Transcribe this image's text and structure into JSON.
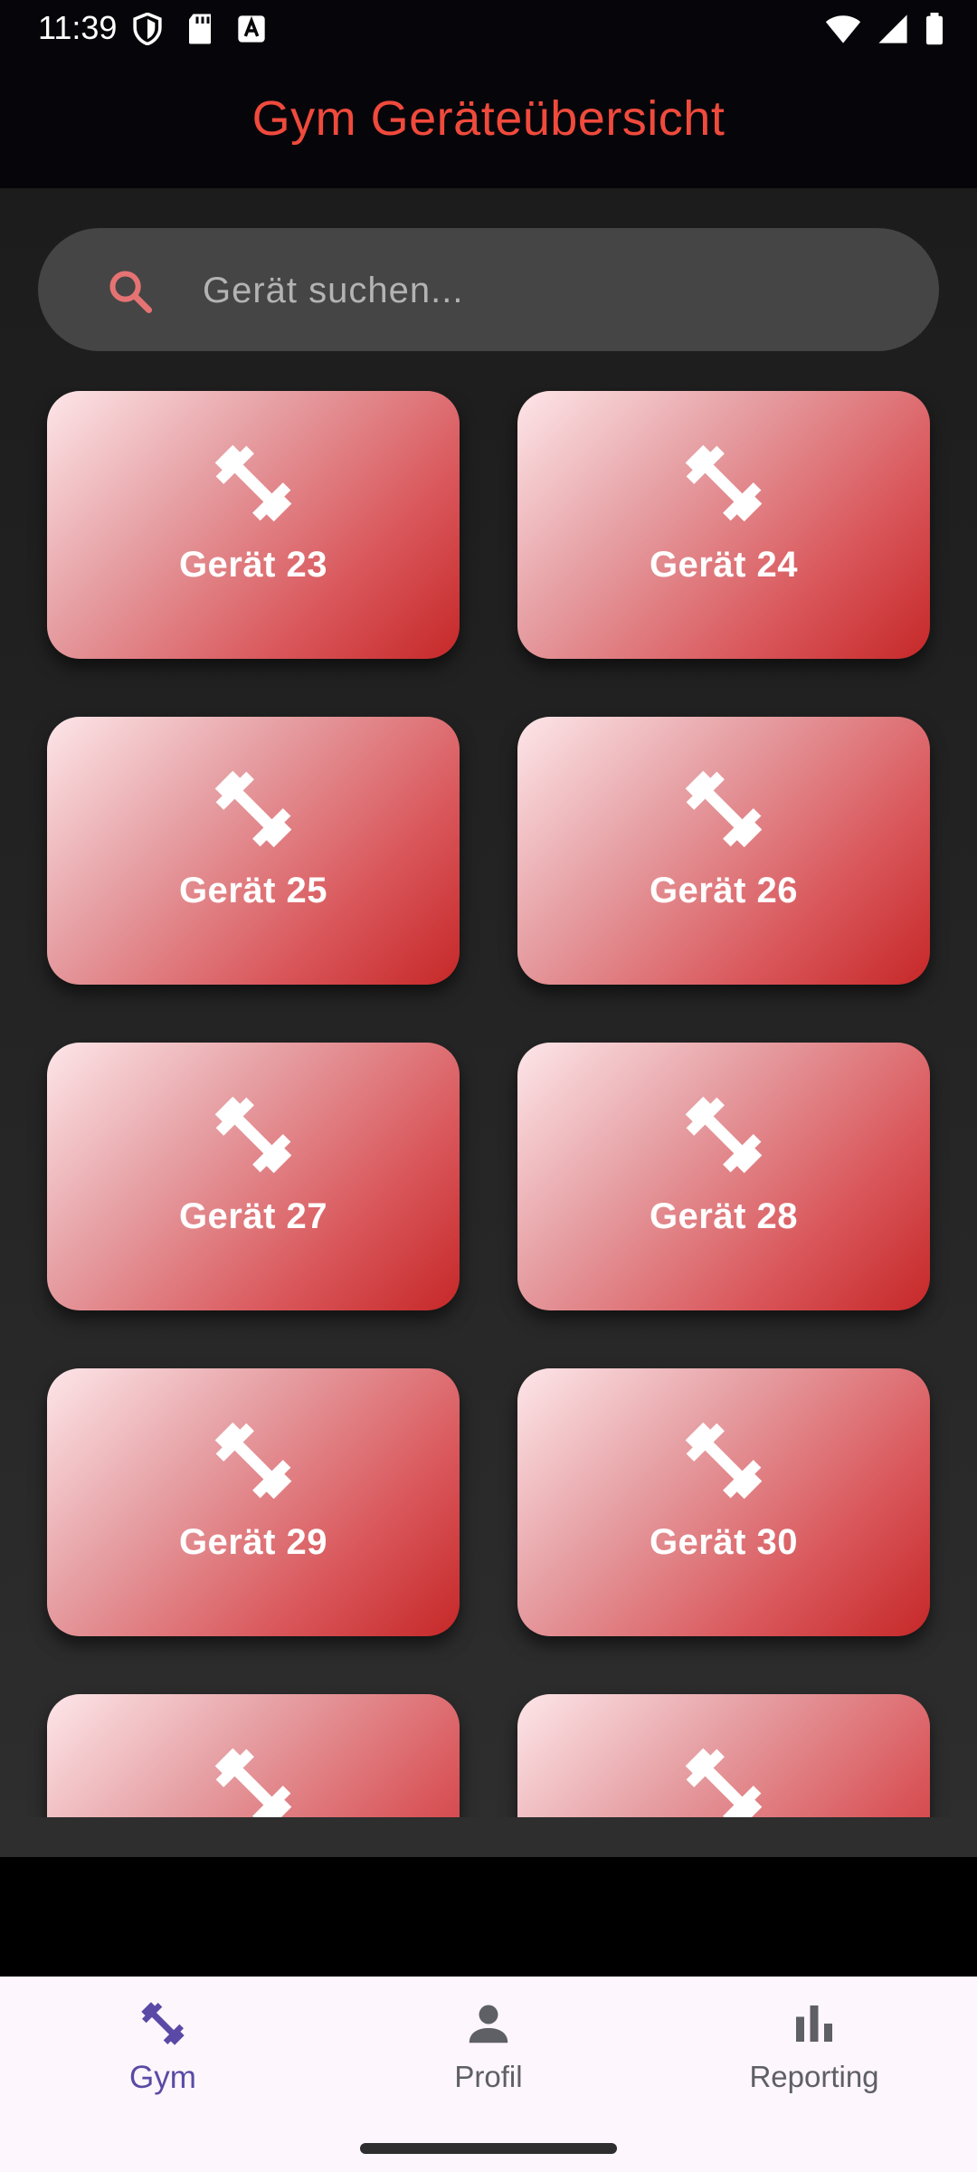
{
  "status_bar": {
    "time": "11:39",
    "left_icons": [
      "shield-icon",
      "sd-card-icon",
      "keyboard-icon"
    ],
    "right_icons": [
      "wifi-icon",
      "cellular-signal-icon",
      "battery-icon"
    ]
  },
  "app_bar": {
    "title": "Gym Geräteübersicht",
    "title_color": "#f04a3c"
  },
  "search": {
    "placeholder": "Gerät suchen...",
    "value": "",
    "icon": "search-icon",
    "icon_color": "#e57373"
  },
  "devices": [
    {
      "label": "Gerät 23",
      "icon": "fitness-center-icon"
    },
    {
      "label": "Gerät 24",
      "icon": "fitness-center-icon"
    },
    {
      "label": "Gerät 25",
      "icon": "fitness-center-icon"
    },
    {
      "label": "Gerät 26",
      "icon": "fitness-center-icon"
    },
    {
      "label": "Gerät 27",
      "icon": "fitness-center-icon"
    },
    {
      "label": "Gerät 28",
      "icon": "fitness-center-icon"
    },
    {
      "label": "Gerät 29",
      "icon": "fitness-center-icon"
    },
    {
      "label": "Gerät 30",
      "icon": "fitness-center-icon"
    },
    {
      "label": "",
      "icon": "fitness-center-icon"
    },
    {
      "label": "",
      "icon": "fitness-center-icon"
    }
  ],
  "bottom_nav": {
    "items": [
      {
        "label": "Gym",
        "icon": "fitness-center-icon",
        "active": true
      },
      {
        "label": "Profil",
        "icon": "person-icon",
        "active": false
      },
      {
        "label": "Reporting",
        "icon": "bar-chart-icon",
        "active": false
      }
    ],
    "active_color": "#5a4aa6",
    "inactive_color": "#5f5f66"
  },
  "colors": {
    "card_gradient_start": "#fde6e9",
    "card_gradient_end": "#c62828",
    "background": "#1c1c1c",
    "search_bg": "#454545"
  }
}
